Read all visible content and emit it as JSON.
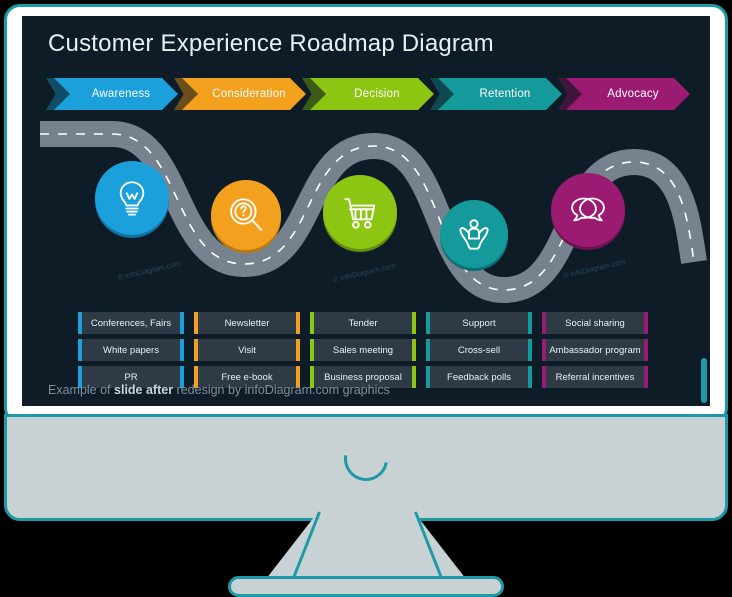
{
  "slide": {
    "title": "Customer Experience Roadmap Diagram",
    "background_color": "#0D1C27",
    "footer": {
      "prefix": "Example of ",
      "bold": "slide after",
      "suffix": " redesign by infoDiagram.com graphics"
    },
    "watermark": "© infoDiagram.com"
  },
  "stages": [
    {
      "label": "Awareness",
      "color": "#1BA0DB",
      "shadow": "#14729E",
      "icon": "lightbulb-icon"
    },
    {
      "label": "Consideration",
      "color": "#F2A01E",
      "shadow": "#B97914",
      "icon": "magnifier-question-icon"
    },
    {
      "label": "Decision",
      "color": "#8CC512",
      "shadow": "#66900C",
      "icon": "shopping-cart-icon"
    },
    {
      "label": "Retention",
      "color": "#149A9B",
      "shadow": "#0E6F70",
      "icon": "hands-person-icon"
    },
    {
      "label": "Advocacy",
      "color": "#9B1B72",
      "shadow": "#6E1251",
      "icon": "speech-bubbles-icon"
    }
  ],
  "table": {
    "rows": [
      [
        "Conferences, Fairs",
        "Newsletter",
        "Tender",
        "Support",
        "Social sharing"
      ],
      [
        "White papers",
        "Visit",
        "Sales meeting",
        "Cross-sell",
        "Ambassador program"
      ],
      [
        "PR",
        "Free e-book",
        "Business proposal",
        "Feedback polls",
        "Referral incentives"
      ]
    ],
    "cell_background": "#2F3A47"
  },
  "monitor": {
    "frame_color": "#1D9AA5",
    "body_color": "#C8D2D4",
    "spinner_color": "#1D9AA5",
    "status": "loading"
  },
  "road": {
    "surface_color": "#76838F",
    "dash_color": "#FFFFFF"
  }
}
